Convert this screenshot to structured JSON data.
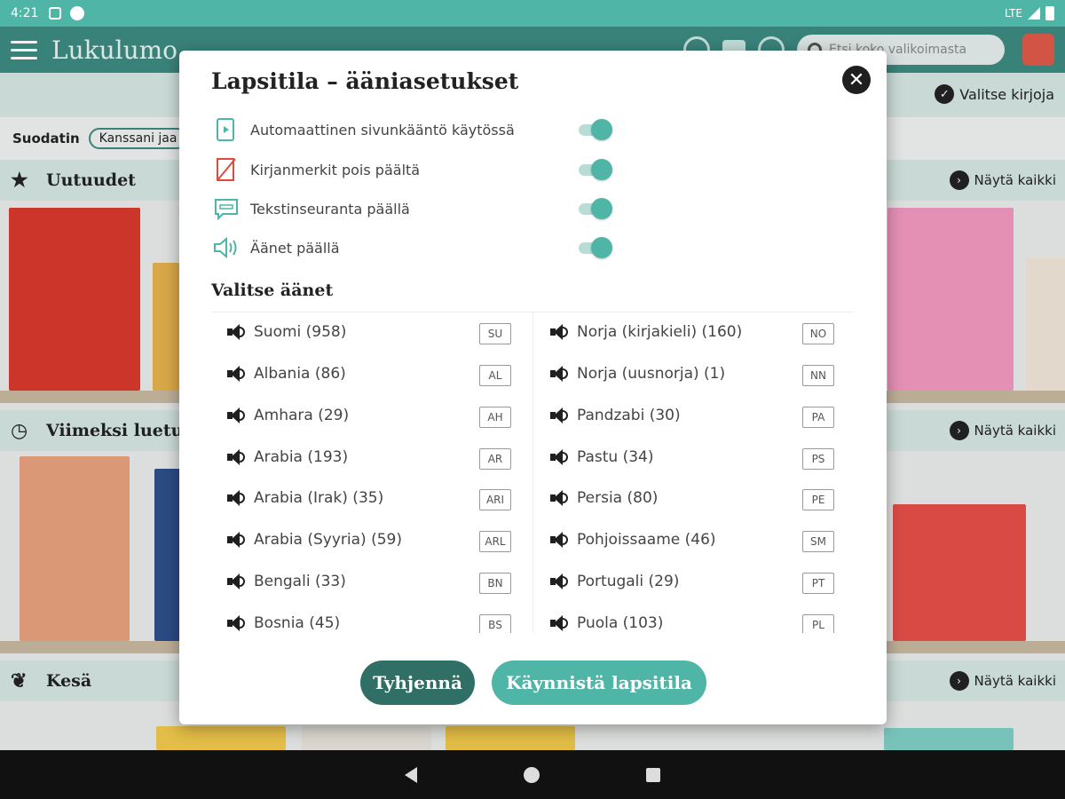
{
  "status_bar": {
    "time": "4:21",
    "network": "LTE"
  },
  "app_bar": {
    "title": "Lukulumo",
    "search_placeholder": "Etsi koko valikoimasta"
  },
  "background": {
    "select_books": "Valitse kirjoja",
    "filter_label": "Suodatin",
    "filter_chip": "Kanssani jaa",
    "sections": [
      {
        "title": "Uutuudet",
        "show_all": "Näytä kaikki"
      },
      {
        "title": "Viimeksi luetu",
        "show_all": "Näytä kaikki"
      },
      {
        "title": "Kesä",
        "show_all": "Näytä kaikki"
      }
    ]
  },
  "dialog": {
    "title": "Lapsitila – ääniasetukset",
    "settings": [
      {
        "label": "Automaattinen sivunkääntö käytössä",
        "icon": "page-turn-icon",
        "on": true
      },
      {
        "label": "Kirjanmerkit pois päältä",
        "icon": "bookmark-off-icon",
        "on": true
      },
      {
        "label": "Tekstinseuranta päällä",
        "icon": "text-follow-icon",
        "on": true
      },
      {
        "label": "Äänet päällä",
        "icon": "speaker-icon",
        "on": true
      }
    ],
    "voices_title": "Valitse äänet",
    "voices_left": [
      {
        "label": "Suomi (958)",
        "code": "SU"
      },
      {
        "label": "Albania (86)",
        "code": "AL"
      },
      {
        "label": "Amhara (29)",
        "code": "AH"
      },
      {
        "label": "Arabia (193)",
        "code": "AR"
      },
      {
        "label": "Arabia (Irak) (35)",
        "code": "ARI"
      },
      {
        "label": "Arabia (Syyria) (59)",
        "code": "ARL"
      },
      {
        "label": "Bengali (33)",
        "code": "BN"
      },
      {
        "label": "Bosnia (45)",
        "code": "BS"
      }
    ],
    "voices_right": [
      {
        "label": "Norja (kirjakieli) (160)",
        "code": "NO"
      },
      {
        "label": "Norja (uusnorja) (1)",
        "code": "NN"
      },
      {
        "label": "Pandzabi (30)",
        "code": "PA"
      },
      {
        "label": "Pastu (34)",
        "code": "PS"
      },
      {
        "label": "Persia (80)",
        "code": "PE"
      },
      {
        "label": "Pohjoissaame (46)",
        "code": "SM"
      },
      {
        "label": "Portugali (29)",
        "code": "PT"
      },
      {
        "label": "Puola (103)",
        "code": "PL"
      }
    ],
    "clear_button": "Tyhjennä",
    "start_button": "Käynnistä lapsitila"
  },
  "colors": {
    "teal": "#4fb5a7",
    "dark_teal": "#2f6f66",
    "app_bar": "#3d8b82"
  }
}
